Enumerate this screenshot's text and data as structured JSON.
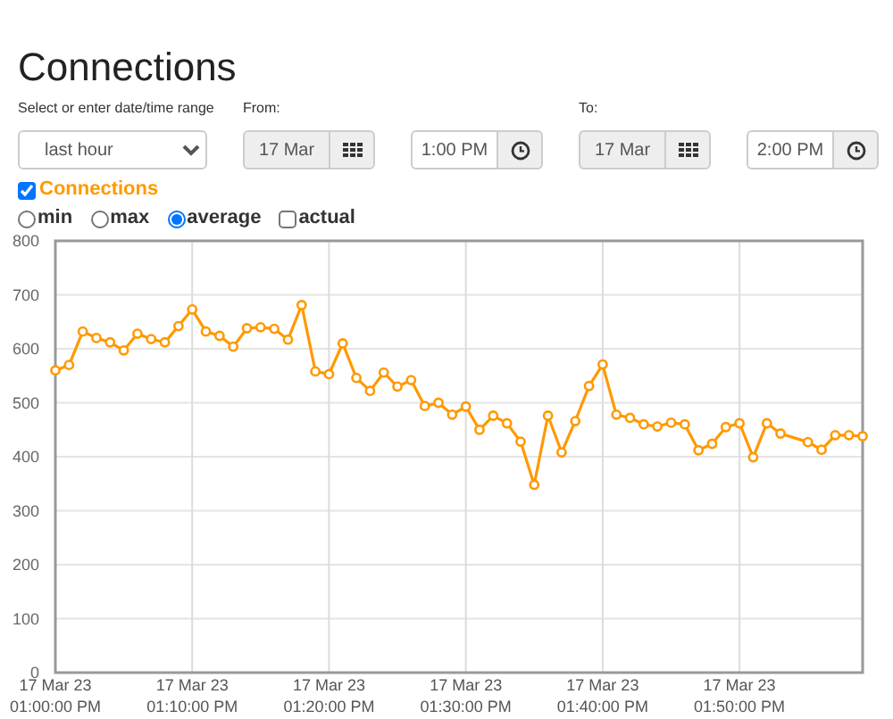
{
  "title": "Connections",
  "range": {
    "label": "Select or enter date/time range",
    "value": "last hour"
  },
  "from": {
    "label": "From:",
    "date": "17 Mar",
    "time": "1:00 PM"
  },
  "to": {
    "label": "To:",
    "date": "17 Mar",
    "time": "2:00 PM"
  },
  "series_toggle": {
    "checked": true
  },
  "modes": [
    {
      "label": "min",
      "kind": "radio",
      "selected": false
    },
    {
      "label": "max",
      "kind": "radio",
      "selected": false
    },
    {
      "label": "average",
      "kind": "radio",
      "selected": true
    },
    {
      "label": "actual",
      "kind": "checkbox",
      "selected": false
    }
  ],
  "chart": {
    "chart_data": {
      "type": "line",
      "categories": [
        "17 Mar 23\n01:00:00 PM",
        null,
        null,
        null,
        null,
        null,
        null,
        null,
        null,
        null,
        "17 Mar 23\n01:10:00 PM",
        null,
        null,
        null,
        null,
        null,
        null,
        null,
        null,
        null,
        "17 Mar 23\n01:20:00 PM",
        null,
        null,
        null,
        null,
        null,
        null,
        null,
        null,
        null,
        "17 Mar 23\n01:30:00 PM",
        null,
        null,
        null,
        null,
        null,
        null,
        null,
        null,
        null,
        "17 Mar 23\n01:40:00 PM",
        null,
        null,
        null,
        null,
        null,
        null,
        null,
        null,
        null,
        "17 Mar 23\n01:50:00 PM",
        null,
        null,
        null,
        null,
        null,
        null,
        null,
        null,
        null
      ],
      "grid": true,
      "series": [
        {
          "name": "Connections",
          "color": "#ff9900",
          "marker": "circle",
          "values": [
            560,
            570,
            632,
            620,
            612,
            597,
            628,
            618,
            612,
            642,
            673,
            632,
            624,
            604,
            638,
            640,
            637,
            617,
            681,
            558,
            553,
            610,
            546,
            522,
            556,
            530,
            542,
            494,
            500,
            478,
            493,
            450,
            476,
            462,
            428,
            348,
            476,
            408,
            466,
            531,
            571,
            478,
            472,
            460,
            456,
            463,
            460,
            412,
            424,
            455,
            462,
            399,
            462,
            443,
            null,
            427,
            413,
            440,
            440,
            438
          ]
        }
      ],
      "ylim": [
        0,
        800
      ],
      "yticks": [
        0,
        100,
        200,
        300,
        400,
        500,
        600,
        700,
        800
      ]
    }
  }
}
